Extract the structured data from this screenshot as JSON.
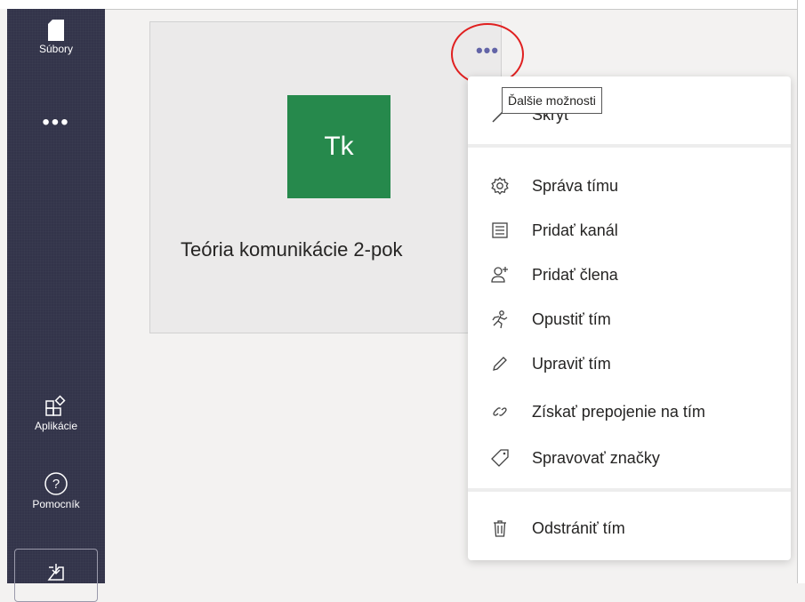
{
  "rail": {
    "files_label": "Súbory",
    "more_label": "•••",
    "apps_label": "Aplikácie",
    "help_label": "Pomocník"
  },
  "team": {
    "initials": "Tk",
    "name": "Teória komunikácie 2-pok",
    "color": "#26894c"
  },
  "more_button": {
    "label": "•••"
  },
  "tooltip": "Ďalšie možnosti",
  "menu": {
    "items": [
      {
        "label": "Skryť",
        "icon": "hide-icon"
      },
      {
        "label": "Správa tímu",
        "icon": "gear-icon"
      },
      {
        "label": "Pridať kanál",
        "icon": "channel-icon"
      },
      {
        "label": "Pridať člena",
        "icon": "add-member-icon"
      },
      {
        "label": "Opustiť tím",
        "icon": "leave-icon"
      },
      {
        "label": "Upraviť tím",
        "icon": "pencil-icon"
      },
      {
        "label": "Získať prepojenie na tím",
        "icon": "link-icon"
      },
      {
        "label": "Spravovať značky",
        "icon": "tag-icon"
      },
      {
        "label": "Odstrániť tím",
        "icon": "trash-icon"
      }
    ]
  },
  "colors": {
    "rail": "#33344a",
    "accent": "#6264a7",
    "highlight": "#e02020"
  }
}
